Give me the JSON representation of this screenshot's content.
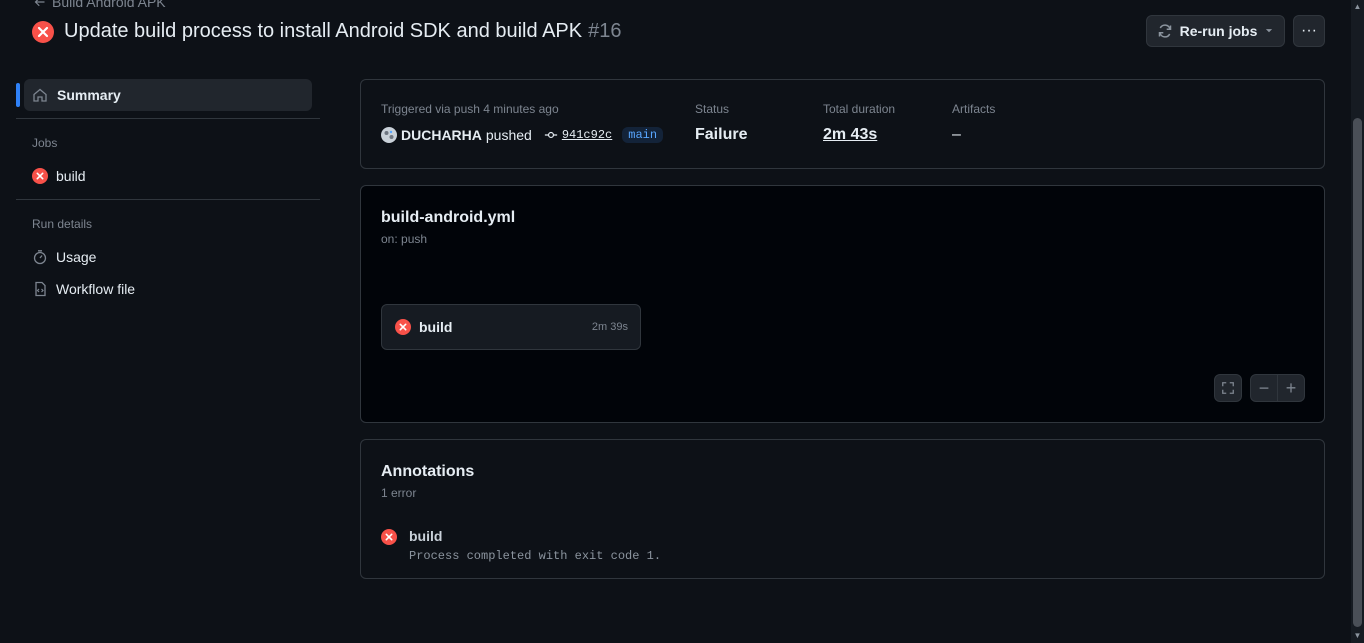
{
  "header": {
    "back_label": "Build Android APK",
    "title": "Update build process to install Android SDK and build APK",
    "run_number": "#16",
    "rerun_label": "Re-run jobs",
    "more_label": "···"
  },
  "sidebar": {
    "summary_label": "Summary",
    "jobs_heading": "Jobs",
    "jobs": [
      {
        "label": "build",
        "status": "failure"
      }
    ],
    "run_details_heading": "Run details",
    "usage_label": "Usage",
    "workflow_file_label": "Workflow file"
  },
  "run_info": {
    "trigger_text": "Triggered via push 4 minutes ago",
    "actor": "DUCHARHA",
    "action": "pushed",
    "commit_sha": "941c92c",
    "branch": "main",
    "status_label": "Status",
    "status_value": "Failure",
    "duration_label": "Total duration",
    "duration_value": "2m 43s",
    "artifacts_label": "Artifacts",
    "artifacts_value": "–"
  },
  "workflow": {
    "file_name": "build-android.yml",
    "trigger": "on: push",
    "job_name": "build",
    "job_duration": "2m 39s",
    "zoom_out_label": "−",
    "zoom_in_label": "+"
  },
  "annotations": {
    "title": "Annotations",
    "count_text": "1 error",
    "items": [
      {
        "job": "build",
        "message": "Process completed with exit code 1."
      }
    ]
  },
  "colors": {
    "failure": "#f85149",
    "accent": "#2f81f7",
    "background": "#0d1117"
  }
}
